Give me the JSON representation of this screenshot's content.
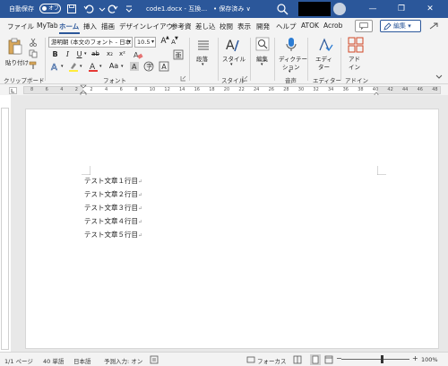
{
  "titlebar": {
    "autosave_label": "自動保存",
    "autosave_state": "オフ",
    "doc_title": "code1.docx - 互換…",
    "save_status": "• 保存済み ∨",
    "minimize": "—",
    "restore": "❐",
    "close": "✕",
    "colors": {
      "bar": "#2b579a"
    }
  },
  "tabs": [
    "ファイル",
    "MyTab",
    "ホーム",
    "挿入",
    "描画",
    "デザイン",
    "レイアウ",
    "参考資",
    "差し込",
    "校閲",
    "表示",
    "開発",
    "ヘルプ",
    "ATOK",
    "Acrob"
  ],
  "header_actions": {
    "edit_label": "編集 ▾",
    "share_icon": "share-icon"
  },
  "ribbon": {
    "clipboard": {
      "paste_label": "貼り付け",
      "group_label": "クリップボード"
    },
    "font": {
      "font_name": "游明朝 (本文のフォント - 日本",
      "font_size": "10.5",
      "grow": "A",
      "shrink": "A",
      "case": "Aa",
      "group_label": "フォント"
    },
    "paragraph": {
      "label": "段落"
    },
    "styles": {
      "label": "スタイル",
      "group_label": "スタイル"
    },
    "editing": {
      "label": "編集"
    },
    "voice": {
      "label_line1": "ディクテー",
      "label_line2": "ション",
      "group_label": "音声"
    },
    "editor": {
      "label_line1": "エディ",
      "label_line2": "ター",
      "group_label": "エディター"
    },
    "addins": {
      "label_line1": "アド",
      "label_line2": "イン",
      "group_label": "アドイン"
    }
  },
  "ruler": {
    "numbers": [
      "8",
      "6",
      "4",
      "2",
      "2",
      "4",
      "6",
      "8",
      "10",
      "12",
      "14",
      "16",
      "18",
      "20",
      "22",
      "24",
      "26",
      "28",
      "30",
      "32",
      "34",
      "36",
      "38",
      "40",
      "42",
      "44",
      "46",
      "48"
    ]
  },
  "document": {
    "lines": [
      "テスト文章１行目",
      "テスト文章２行目",
      "テスト文章３行目",
      "テスト文章４行目",
      "テスト文章５行目"
    ],
    "paragraph_mark": "↵"
  },
  "statusbar": {
    "page": "1/1 ページ",
    "words": "40 単語",
    "language": "日本語",
    "ime": "予測入力: オン",
    "focus": "フォーカス",
    "zoom": "100%",
    "zoom_level": 1.0
  }
}
